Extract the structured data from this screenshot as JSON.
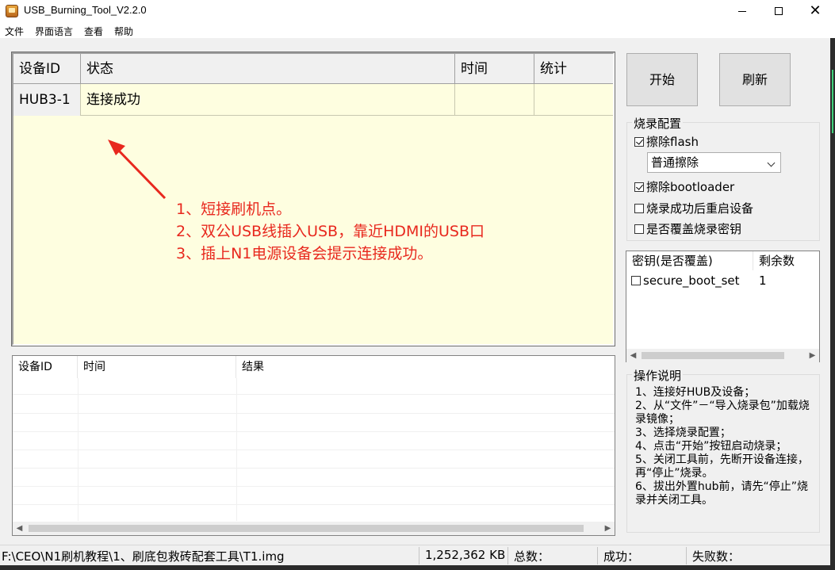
{
  "window": {
    "title": "USB_Burning_Tool_V2.2.0"
  },
  "menu": [
    "文件",
    "界面语言",
    "查看",
    "帮助"
  ],
  "device_table": {
    "columns": [
      "设备ID",
      "状态",
      "时间",
      "统计"
    ],
    "rows": [
      {
        "id": "HUB3-1",
        "status": "连接成功",
        "time": "",
        "count": ""
      }
    ]
  },
  "annotation": {
    "color": "#e8281e",
    "lines": [
      "1、短接刷机点。",
      "2、双公USB线插入USB，靠近HDMI的USB口",
      "3、插上N1电源设备会提示连接成功。"
    ]
  },
  "result_table": {
    "columns": [
      "设备ID",
      "时间",
      "结果"
    ]
  },
  "buttons": {
    "start": "开始",
    "refresh": "刷新"
  },
  "config": {
    "title": "烧录配置",
    "erase_flash": {
      "label": "擦除flash",
      "checked": true
    },
    "erase_mode": "普通擦除",
    "erase_bootloader": {
      "label": "擦除bootloader",
      "checked": true
    },
    "reboot_after": {
      "label": "烧录成功后重启设备",
      "checked": false
    },
    "overwrite_key": {
      "label": "是否覆盖烧录密钥",
      "checked": false
    }
  },
  "key_list": {
    "columns": [
      "密钥(是否覆盖)",
      "剩余数"
    ],
    "rows": [
      {
        "name": "secure_boot_set",
        "remaining": "1",
        "checked": false
      }
    ]
  },
  "help": {
    "title": "操作说明",
    "text": "1、连接好HUB及设备；\n2、从“文件”－“导入烧录包”加载烧录镜像；\n3、选择烧录配置；\n4、点击“开始”按钮启动烧录；\n5、关闭工具前，先断开设备连接，再“停止”烧录。\n6、拔出外置hub前，请先“停止”烧录并关闭工具。"
  },
  "status": {
    "path": "F:\\CEO\\N1刷机教程\\1、刷底包救砖配套工具\\T1.img",
    "size": "1,252,362 KB",
    "total": "总数：",
    "success": "成功：",
    "failed": "失败数："
  }
}
